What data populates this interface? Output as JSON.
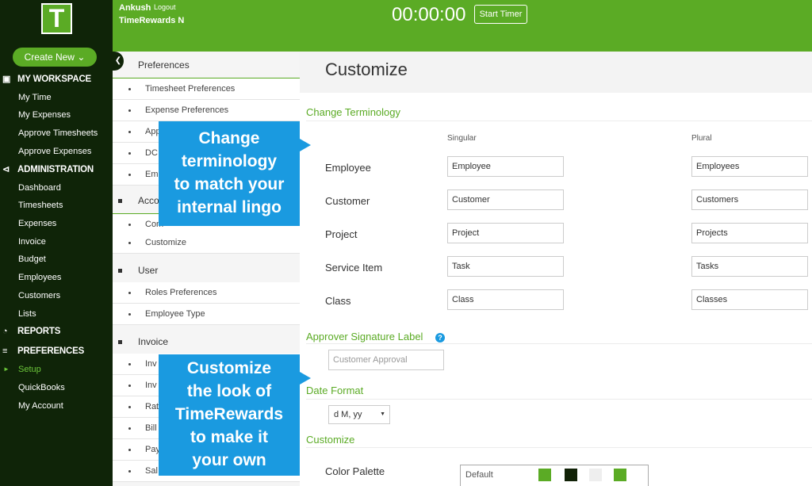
{
  "app": {
    "logo_letter": "T",
    "create_new_label": "Create New"
  },
  "sidebar": {
    "workspace_label": "MY WORKSPACE",
    "workspace_items": [
      "My Time",
      "My Expenses",
      "Approve Timesheets",
      "Approve Expenses"
    ],
    "admin_label": "ADMINISTRATION",
    "admin_items": [
      "Dashboard",
      "Timesheets",
      "Expenses",
      "Invoice",
      "Budget",
      "Employees",
      "Customers",
      "Lists"
    ],
    "reports_label": "REPORTS",
    "preferences_label": "PREFERENCES",
    "preferences_items": [
      "Setup",
      "QuickBooks",
      "My Account"
    ]
  },
  "topbar": {
    "user_name": "Ankush",
    "logout_label": "Logout",
    "company_name": "TimeRewards N",
    "timer_value": "00:00:00",
    "start_timer_label": "Start Timer"
  },
  "prefs_nav": {
    "preferences_head": "Preferences",
    "preferences_items": [
      "Timesheet Preferences",
      "Expense Preferences",
      "App",
      "DC",
      "Em"
    ],
    "account_head": "Acco",
    "account_items": [
      "Com",
      "Customize"
    ],
    "user_head": "User",
    "user_items": [
      "Roles Preferences",
      "Employee Type"
    ],
    "invoice_head": "Invoice",
    "invoice_items": [
      "Inv",
      "Inv",
      "Rat",
      "Bill",
      "Pay",
      "Sal"
    ]
  },
  "callouts": {
    "terminology": [
      "Change",
      "terminology",
      "to match your",
      "internal lingo"
    ],
    "customize": [
      "Customize",
      "the look of",
      "TimeRewards",
      "to make it",
      "your own"
    ]
  },
  "main": {
    "title": "Customize",
    "terminology_title": "Change Terminology",
    "singular_label": "Singular",
    "plural_label": "Plural",
    "terms": [
      {
        "label": "Employee",
        "singular": "Employee",
        "plural": "Employees"
      },
      {
        "label": "Customer",
        "singular": "Customer",
        "plural": "Customers"
      },
      {
        "label": "Project",
        "singular": "Project",
        "plural": "Projects"
      },
      {
        "label": "Service Item",
        "singular": "Task",
        "plural": "Tasks"
      },
      {
        "label": "Class",
        "singular": "Class",
        "plural": "Classes"
      }
    ],
    "approver_title": "Approver Signature Label",
    "approver_placeholder": "Customer Approval",
    "date_format_title": "Date Format",
    "date_format_value": "d M, yy",
    "customize_title": "Customize",
    "color_palette_label": "Color Palette",
    "palette_name": "Default",
    "palette_colors": [
      "#5bab25",
      "#112207",
      "#eeeeee",
      "#5bab25"
    ]
  }
}
